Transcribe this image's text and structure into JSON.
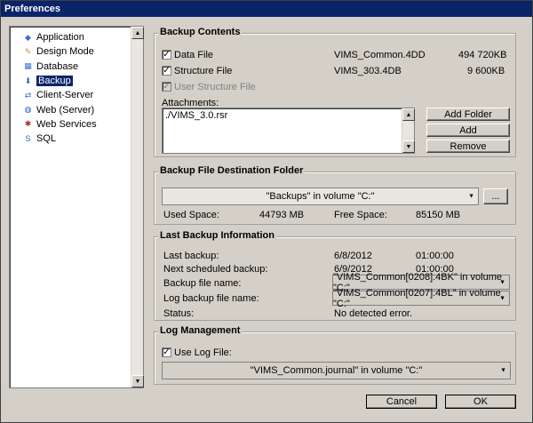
{
  "window": {
    "title": "Preferences"
  },
  "sidebar": {
    "items": [
      {
        "label": "Application",
        "icon": "application-icon",
        "color": "#3a6fd8"
      },
      {
        "label": "Design Mode",
        "icon": "design-mode-icon",
        "color": "#c89030"
      },
      {
        "label": "Database",
        "icon": "database-icon",
        "color": "#3a6fd8"
      },
      {
        "label": "Backup",
        "icon": "backup-icon",
        "color": "#2a62c8",
        "selected": true
      },
      {
        "label": "Client-Server",
        "icon": "client-server-icon",
        "color": "#3a6fd8"
      },
      {
        "label": "Web (Server)",
        "icon": "web-server-icon",
        "color": "#2a62c8"
      },
      {
        "label": "Web Services",
        "icon": "web-services-icon",
        "color": "#b03030"
      },
      {
        "label": "SQL",
        "icon": "sql-icon",
        "color": "#2a62c8"
      }
    ]
  },
  "backup_contents": {
    "title": "Backup Contents",
    "data_file": {
      "label": "Data File",
      "name": "VIMS_Common.4DD",
      "size": "494 720KB",
      "checked": true
    },
    "structure_file": {
      "label": "Structure File",
      "name": "VIMS_303.4DB",
      "size": "9 600KB",
      "checked": true
    },
    "user_structure_file": {
      "label": "User Structure File",
      "checked": true,
      "disabled": true
    },
    "attachments_label": "Attachments:",
    "attachments": [
      "./VIMS_3.0.rsr"
    ],
    "add_folder": "Add Folder",
    "add": "Add",
    "remove": "Remove"
  },
  "destination": {
    "title": "Backup File Destination Folder",
    "folder": "\"Backups\" in volume \"C:\"",
    "browse": "...",
    "used_label": "Used Space:",
    "used_value": "44793 MB",
    "free_label": "Free Space:",
    "free_value": "85150 MB"
  },
  "last_backup": {
    "title": "Last Backup Information",
    "last_label": "Last backup:",
    "last_date": "6/8/2012",
    "last_time": "01:00:00",
    "next_label": "Next scheduled backup:",
    "next_date": "6/9/2012",
    "next_time": "01:00:00",
    "file_label": "Backup file name:",
    "file_value": "\"VIMS_Common[0208].4BK\" in volume \"C:\"",
    "log_label": "Log backup file name:",
    "log_value": "\"VIMS_Common[0207].4BL\" in volume \"C:\"",
    "status_label": "Status:",
    "status_value": "No detected error."
  },
  "log_management": {
    "title": "Log Management",
    "use_log_label": "Use Log File:",
    "use_log_checked": true,
    "log_file": "\"VIMS_Common.journal\" in volume \"C:\""
  },
  "footer": {
    "cancel": "Cancel",
    "ok": "OK"
  }
}
